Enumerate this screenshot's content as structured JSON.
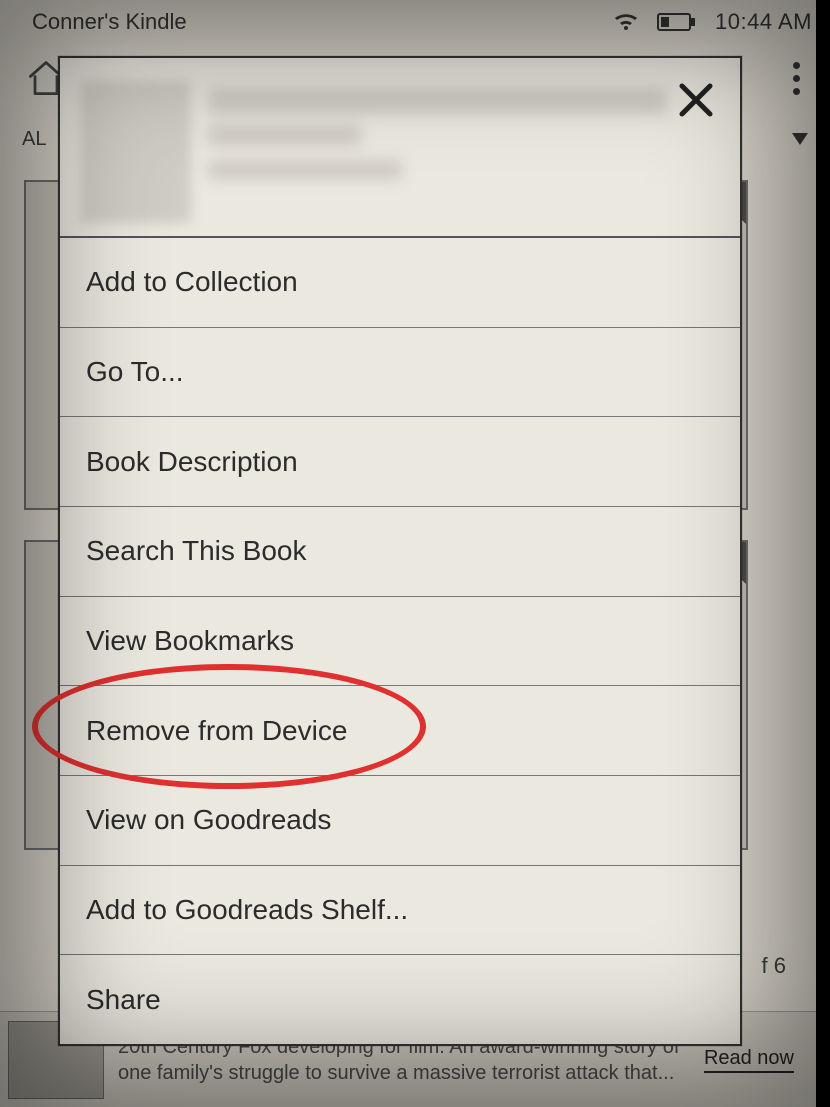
{
  "status": {
    "device_name": "Conner's Kindle",
    "time": "10:44 AM"
  },
  "filter": {
    "label": "AL"
  },
  "library": {
    "badge1": "%",
    "badge2": "%"
  },
  "modal": {
    "items": [
      "Add to Collection",
      "Go To...",
      "Book Description",
      "Search This Book",
      "View Bookmarks",
      "Remove from Device",
      "View on Goodreads",
      "Add to Goodreads Shelf...",
      "Share"
    ]
  },
  "page_count": "f 6",
  "ad": {
    "text": "20th Century Fox developing for film. An award-winning story of one family's struggle to survive a massive terrorist attack that...",
    "cta": "Read now"
  },
  "annotation": {
    "highlighted_item_index": 5
  }
}
